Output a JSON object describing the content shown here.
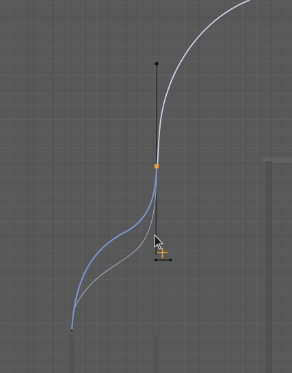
{
  "viewport": {
    "background_color": "#585858",
    "grid_minor_color": "#616161",
    "grid_major_color": "#4f4f4f",
    "grid": "on"
  },
  "curve": {
    "color": "#c7d2ea",
    "selected_color": "#7f96d6",
    "ghost_color": "#b9c3d7"
  },
  "control_point": {
    "color": "#f0a23a",
    "handle_color": "#2a2a2a",
    "handle_end_color": "#111111"
  },
  "cursor": {
    "pointer_icon": "mouse-pointer-icon",
    "crosshair_icon": "3d-cursor-icon",
    "crosshair_color": "#f0a23a"
  }
}
